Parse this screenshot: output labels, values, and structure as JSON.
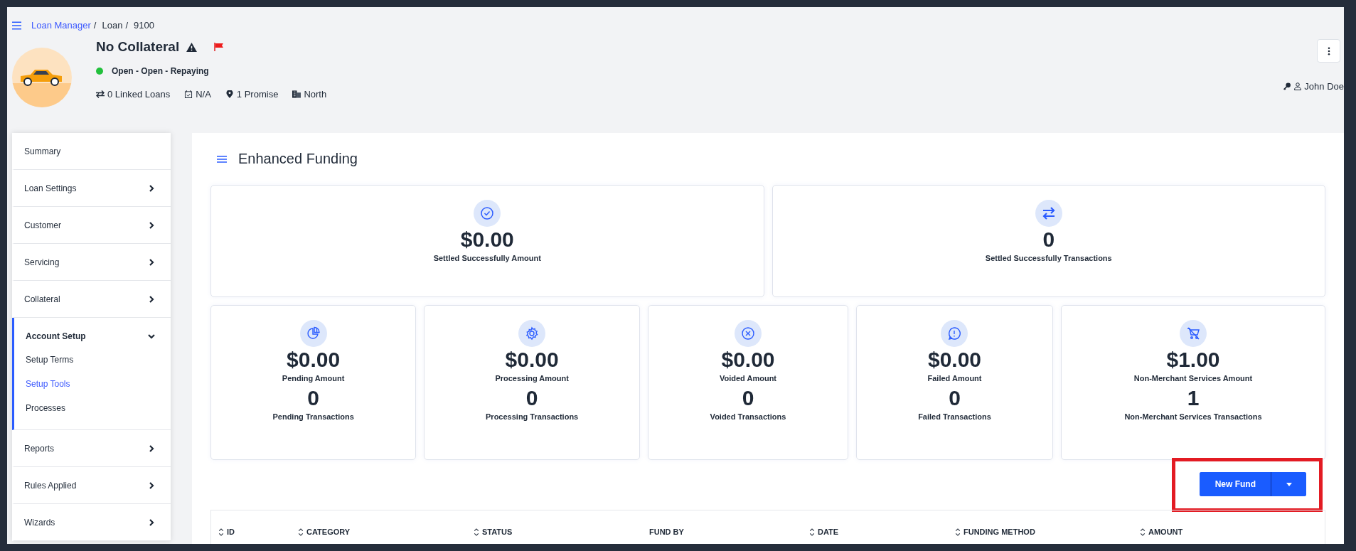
{
  "breadcrumb": [
    {
      "label": "Loan Manager",
      "kind": "link",
      "separator": "/"
    },
    {
      "label": "Loan",
      "kind": "text",
      "separator": "/"
    },
    {
      "label": "9100",
      "kind": "text"
    }
  ],
  "loan": {
    "title": "No Collateral",
    "flagged": true,
    "warning": true,
    "status": {
      "label": "Open - Open - Repaying",
      "color": "#22c03c"
    },
    "meta": [
      {
        "kind": "linked",
        "text": "0 Linked Loans"
      },
      {
        "kind": "calendar",
        "text": "N/A"
      },
      {
        "kind": "pin",
        "text": "1 Promise"
      },
      {
        "kind": "building",
        "text": "North"
      }
    ],
    "user": "John Doe"
  },
  "sidebar": [
    {
      "label": "Summary",
      "selected": false
    },
    {
      "label": "Loan Settings",
      "selected": false,
      "expanded": false
    },
    {
      "label": "Customer",
      "selected": false,
      "expanded": false
    },
    {
      "label": "Servicing",
      "selected": false,
      "expanded": false
    },
    {
      "label": "Collateral",
      "selected": false,
      "expanded": false
    },
    {
      "label": "Account Setup",
      "selected": true,
      "expanded": true,
      "children": [
        {
          "label": "Setup Terms",
          "selected": false
        },
        {
          "label": "Setup Tools",
          "selected": true
        },
        {
          "label": "Processes",
          "selected": false
        }
      ]
    },
    {
      "label": "Reports",
      "selected": false,
      "expanded": false
    },
    {
      "label": "Rules Applied",
      "selected": false,
      "expanded": false
    },
    {
      "label": "Wizards",
      "selected": false,
      "expanded": false
    }
  ],
  "page_title": "Enhanced Funding",
  "summary_cards": [
    {
      "kind": "check",
      "value": "$0.00",
      "label": "Settled Successfully Amount"
    },
    {
      "kind": "swap",
      "value": "0",
      "label": "Settled Successfully Transactions"
    }
  ],
  "stat_cards": [
    {
      "kind": "pie",
      "amount": "$0.00",
      "amount_label": "Pending Amount",
      "count": "0",
      "count_label": "Pending Transactions"
    },
    {
      "kind": "gear",
      "amount": "$0.00",
      "amount_label": "Processing Amount",
      "count": "0",
      "count_label": "Processing Transactions"
    },
    {
      "kind": "x",
      "amount": "$0.00",
      "amount_label": "Voided Amount",
      "count": "0",
      "count_label": "Voided Transactions"
    },
    {
      "kind": "alert",
      "amount": "$0.00",
      "amount_label": "Failed Amount",
      "count": "0",
      "count_label": "Failed Transactions"
    },
    {
      "kind": "cart",
      "amount": "$1.00",
      "amount_label": "Non-Merchant Services Amount",
      "count": "1",
      "count_label": "Non-Merchant Services Transactions"
    }
  ],
  "new_fund_button": {
    "label": "New Fund",
    "highlighted": true
  },
  "table": {
    "columns": [
      {
        "label": "ID",
        "sortable": true
      },
      {
        "label": "CATEGORY",
        "sortable": true
      },
      {
        "label": "STATUS",
        "sortable": true
      },
      {
        "label": "FUND BY",
        "sortable": false
      },
      {
        "label": "DATE",
        "sortable": true
      },
      {
        "label": "FUNDING METHOD",
        "sortable": true
      },
      {
        "label": "AMOUNT",
        "sortable": true
      }
    ]
  }
}
